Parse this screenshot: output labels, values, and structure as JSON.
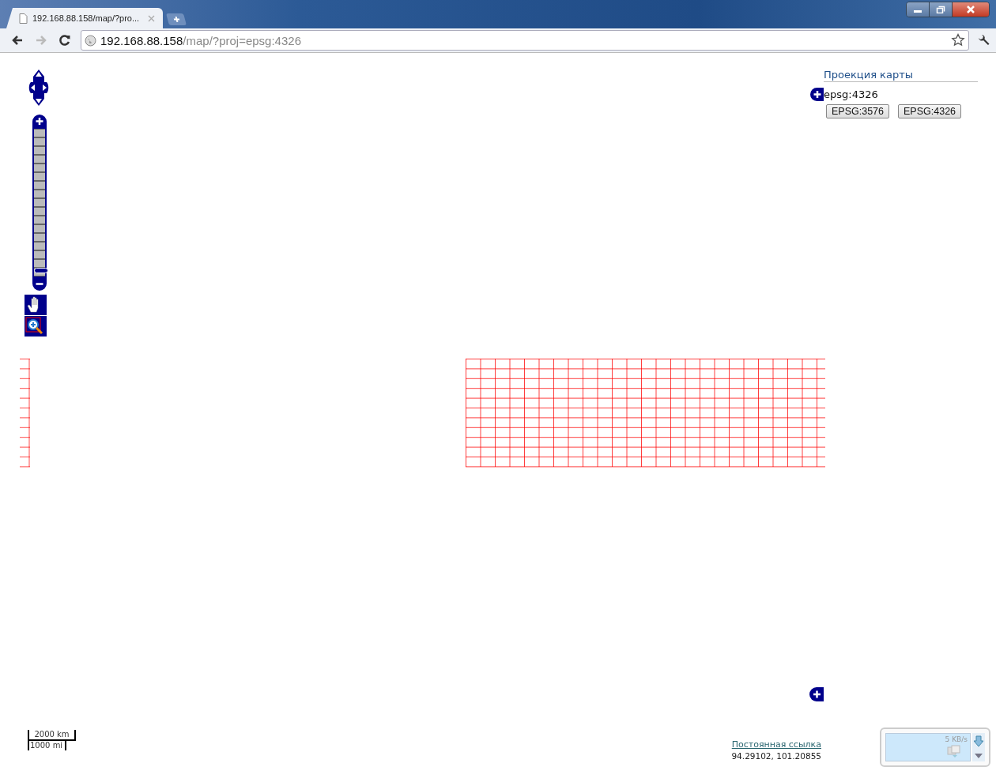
{
  "browser": {
    "tab": {
      "title": "192.168.88.158/map/?pro...",
      "selected": true
    },
    "address": {
      "host": "192.168.88.158",
      "path": "/map/?proj=epsg:4326"
    }
  },
  "map": {
    "zoom_slider": {
      "level": 0
    },
    "layer_switcher": {
      "title": "Проекция карты",
      "current": "epsg:4326",
      "buttons": [
        "EPSG:3576",
        "EPSG:4326"
      ]
    },
    "scale": {
      "top": "2000 km",
      "bottom": "1000 mi"
    },
    "permalink": "Постоянная ссылка",
    "coordinates": "94.29102, 101.20855"
  },
  "net_meter": {
    "speed": "5 KB/s"
  }
}
